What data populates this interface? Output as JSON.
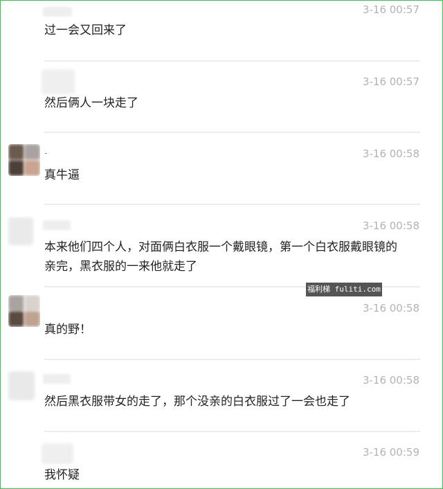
{
  "watermark": "福利梯 fuliti.com",
  "comments": [
    {
      "time": "3-16 00:57",
      "text": "过一会又回来了"
    },
    {
      "time": "3-16 00:57",
      "text": "然后俩人一块走了"
    },
    {
      "name": "-",
      "time": "3-16 00:58",
      "text": "真牛逼"
    },
    {
      "time": "3-16 00:58",
      "text": "本来他们四个人，对面俩白衣服一个戴眼镜，第一个白衣服戴眼镜的亲完，黑衣服的一来他就走了"
    },
    {
      "time": "3-16 00:58",
      "text": "真的野！"
    },
    {
      "time": "3-16 00:58",
      "text": "然后黑衣服带女的走了，那个没亲的白衣服过了一会也走了"
    },
    {
      "time": "3-16 00:59",
      "text": "我怀疑"
    }
  ]
}
